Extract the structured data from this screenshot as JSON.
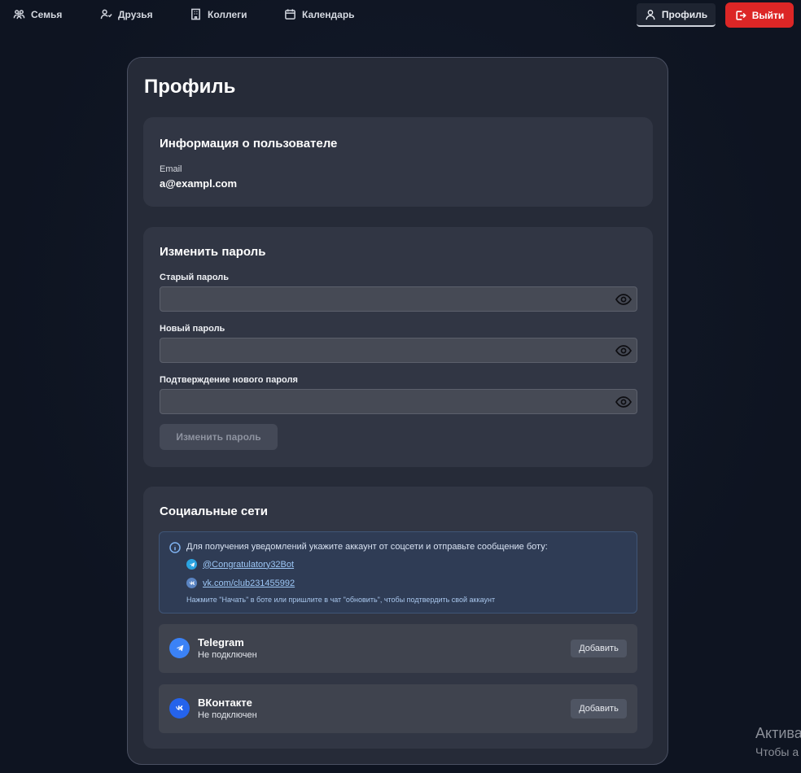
{
  "nav": {
    "family": "Семья",
    "friends": "Друзья",
    "colleagues": "Коллеги",
    "calendar": "Календарь",
    "profile": "Профиль",
    "logout": "Выйти"
  },
  "page": {
    "title": "Профиль"
  },
  "user_info": {
    "title": "Информация о пользователе",
    "email_label": "Email",
    "email_value": "a@exampl.com"
  },
  "password": {
    "title": "Изменить пароль",
    "old_label": "Старый пароль",
    "new_label": "Новый пароль",
    "confirm_label": "Подтверждение нового пароля",
    "old_value": "",
    "new_value": "",
    "confirm_value": "",
    "submit_label": "Изменить пароль"
  },
  "social": {
    "title": "Социальные сети",
    "info_text": "Для получения уведомлений укажите аккаунт от соцсети и отправьте сообщение боту:",
    "telegram_bot": "@Congratulatory32Bot",
    "vk_bot": "vk.com/club231455992",
    "hint": "Нажмите \"Начать\" в боте или пришлите в чат \"обновить\", чтобы подтвердить свой аккаунт",
    "accounts": [
      {
        "name": "Telegram",
        "status": "Не подключен",
        "button": "Добавить"
      },
      {
        "name": "ВКонтакте",
        "status": "Не подключен",
        "button": "Добавить"
      }
    ]
  },
  "watermark": {
    "title": "Актива",
    "subtitle": "Чтобы а"
  },
  "colors": {
    "logout": "#dc2626",
    "link": "#9cc6f5",
    "telegram": "#3b82f6",
    "vk": "#2563eb"
  }
}
